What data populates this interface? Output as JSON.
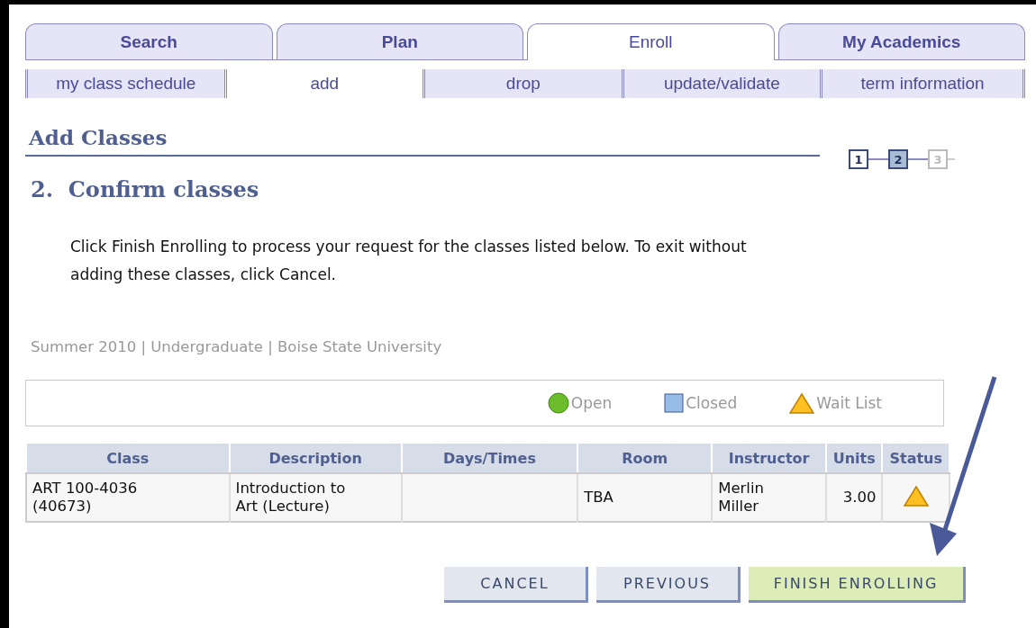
{
  "tabs": [
    {
      "label": "Search",
      "selected": false
    },
    {
      "label": "Plan",
      "selected": false
    },
    {
      "label": "Enroll",
      "selected": true
    },
    {
      "label": "My Academics",
      "selected": false
    }
  ],
  "subtabs": [
    {
      "label": "my class schedule",
      "selected": false
    },
    {
      "label": "add",
      "selected": true
    },
    {
      "label": "drop",
      "selected": false
    },
    {
      "label": "update/validate",
      "selected": false
    },
    {
      "label": "term information",
      "selected": false
    }
  ],
  "page_title": "Add Classes",
  "steps": [
    {
      "label": "1",
      "selected": false,
      "disabled": false
    },
    {
      "label": "2",
      "selected": true,
      "disabled": false
    },
    {
      "label": "3",
      "selected": false,
      "disabled": true
    }
  ],
  "step_title": "2.  Confirm classes",
  "instructions": "Click Finish Enrolling to process your request for the classes listed below. To exit without adding these classes, click Cancel.",
  "term": "Summer 2010 | Undergraduate | Boise State University",
  "legend": [
    {
      "kind": "open",
      "label": "Open"
    },
    {
      "kind": "closed",
      "label": "Closed"
    },
    {
      "kind": "wait_list",
      "label": "Wait List"
    }
  ],
  "table": {
    "columns": [
      "Class",
      "Description",
      "Days/Times",
      "Room",
      "Instructor",
      "Units",
      "Status"
    ],
    "rows": [
      {
        "class": "ART 100-4036 (40673)",
        "description": "Introduction to Art (Lecture)",
        "room": "TBA",
        "instructor": "Merlin Miller",
        "units": "3.00",
        "status": {
          "kind": "wait_list"
        }
      }
    ]
  },
  "buttons": [
    {
      "label": "CANCEL",
      "kind": "plain"
    },
    {
      "label": "PREVIOUS",
      "kind": "plain"
    },
    {
      "label": "FINISH ENROLLING",
      "kind": "primary"
    }
  ]
}
